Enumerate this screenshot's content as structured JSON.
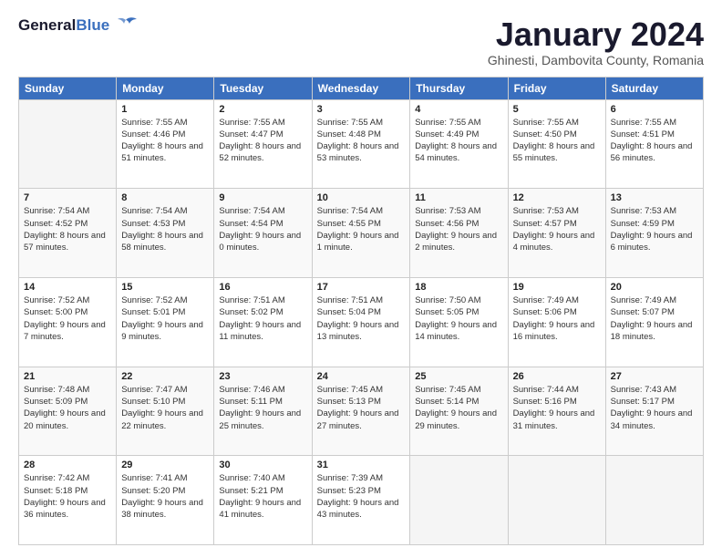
{
  "header": {
    "logo_line1": "General",
    "logo_line2": "Blue",
    "month": "January 2024",
    "location": "Ghinesti, Dambovita County, Romania"
  },
  "weekdays": [
    "Sunday",
    "Monday",
    "Tuesday",
    "Wednesday",
    "Thursday",
    "Friday",
    "Saturday"
  ],
  "weeks": [
    [
      {
        "day": "",
        "sunrise": "",
        "sunset": "",
        "daylight": "",
        "empty": true
      },
      {
        "day": "1",
        "sunrise": "Sunrise: 7:55 AM",
        "sunset": "Sunset: 4:46 PM",
        "daylight": "Daylight: 8 hours and 51 minutes."
      },
      {
        "day": "2",
        "sunrise": "Sunrise: 7:55 AM",
        "sunset": "Sunset: 4:47 PM",
        "daylight": "Daylight: 8 hours and 52 minutes."
      },
      {
        "day": "3",
        "sunrise": "Sunrise: 7:55 AM",
        "sunset": "Sunset: 4:48 PM",
        "daylight": "Daylight: 8 hours and 53 minutes."
      },
      {
        "day": "4",
        "sunrise": "Sunrise: 7:55 AM",
        "sunset": "Sunset: 4:49 PM",
        "daylight": "Daylight: 8 hours and 54 minutes."
      },
      {
        "day": "5",
        "sunrise": "Sunrise: 7:55 AM",
        "sunset": "Sunset: 4:50 PM",
        "daylight": "Daylight: 8 hours and 55 minutes."
      },
      {
        "day": "6",
        "sunrise": "Sunrise: 7:55 AM",
        "sunset": "Sunset: 4:51 PM",
        "daylight": "Daylight: 8 hours and 56 minutes."
      }
    ],
    [
      {
        "day": "7",
        "sunrise": "Sunrise: 7:54 AM",
        "sunset": "Sunset: 4:52 PM",
        "daylight": "Daylight: 8 hours and 57 minutes."
      },
      {
        "day": "8",
        "sunrise": "Sunrise: 7:54 AM",
        "sunset": "Sunset: 4:53 PM",
        "daylight": "Daylight: 8 hours and 58 minutes."
      },
      {
        "day": "9",
        "sunrise": "Sunrise: 7:54 AM",
        "sunset": "Sunset: 4:54 PM",
        "daylight": "Daylight: 9 hours and 0 minutes."
      },
      {
        "day": "10",
        "sunrise": "Sunrise: 7:54 AM",
        "sunset": "Sunset: 4:55 PM",
        "daylight": "Daylight: 9 hours and 1 minute."
      },
      {
        "day": "11",
        "sunrise": "Sunrise: 7:53 AM",
        "sunset": "Sunset: 4:56 PM",
        "daylight": "Daylight: 9 hours and 2 minutes."
      },
      {
        "day": "12",
        "sunrise": "Sunrise: 7:53 AM",
        "sunset": "Sunset: 4:57 PM",
        "daylight": "Daylight: 9 hours and 4 minutes."
      },
      {
        "day": "13",
        "sunrise": "Sunrise: 7:53 AM",
        "sunset": "Sunset: 4:59 PM",
        "daylight": "Daylight: 9 hours and 6 minutes."
      }
    ],
    [
      {
        "day": "14",
        "sunrise": "Sunrise: 7:52 AM",
        "sunset": "Sunset: 5:00 PM",
        "daylight": "Daylight: 9 hours and 7 minutes."
      },
      {
        "day": "15",
        "sunrise": "Sunrise: 7:52 AM",
        "sunset": "Sunset: 5:01 PM",
        "daylight": "Daylight: 9 hours and 9 minutes."
      },
      {
        "day": "16",
        "sunrise": "Sunrise: 7:51 AM",
        "sunset": "Sunset: 5:02 PM",
        "daylight": "Daylight: 9 hours and 11 minutes."
      },
      {
        "day": "17",
        "sunrise": "Sunrise: 7:51 AM",
        "sunset": "Sunset: 5:04 PM",
        "daylight": "Daylight: 9 hours and 13 minutes."
      },
      {
        "day": "18",
        "sunrise": "Sunrise: 7:50 AM",
        "sunset": "Sunset: 5:05 PM",
        "daylight": "Daylight: 9 hours and 14 minutes."
      },
      {
        "day": "19",
        "sunrise": "Sunrise: 7:49 AM",
        "sunset": "Sunset: 5:06 PM",
        "daylight": "Daylight: 9 hours and 16 minutes."
      },
      {
        "day": "20",
        "sunrise": "Sunrise: 7:49 AM",
        "sunset": "Sunset: 5:07 PM",
        "daylight": "Daylight: 9 hours and 18 minutes."
      }
    ],
    [
      {
        "day": "21",
        "sunrise": "Sunrise: 7:48 AM",
        "sunset": "Sunset: 5:09 PM",
        "daylight": "Daylight: 9 hours and 20 minutes."
      },
      {
        "day": "22",
        "sunrise": "Sunrise: 7:47 AM",
        "sunset": "Sunset: 5:10 PM",
        "daylight": "Daylight: 9 hours and 22 minutes."
      },
      {
        "day": "23",
        "sunrise": "Sunrise: 7:46 AM",
        "sunset": "Sunset: 5:11 PM",
        "daylight": "Daylight: 9 hours and 25 minutes."
      },
      {
        "day": "24",
        "sunrise": "Sunrise: 7:45 AM",
        "sunset": "Sunset: 5:13 PM",
        "daylight": "Daylight: 9 hours and 27 minutes."
      },
      {
        "day": "25",
        "sunrise": "Sunrise: 7:45 AM",
        "sunset": "Sunset: 5:14 PM",
        "daylight": "Daylight: 9 hours and 29 minutes."
      },
      {
        "day": "26",
        "sunrise": "Sunrise: 7:44 AM",
        "sunset": "Sunset: 5:16 PM",
        "daylight": "Daylight: 9 hours and 31 minutes."
      },
      {
        "day": "27",
        "sunrise": "Sunrise: 7:43 AM",
        "sunset": "Sunset: 5:17 PM",
        "daylight": "Daylight: 9 hours and 34 minutes."
      }
    ],
    [
      {
        "day": "28",
        "sunrise": "Sunrise: 7:42 AM",
        "sunset": "Sunset: 5:18 PM",
        "daylight": "Daylight: 9 hours and 36 minutes."
      },
      {
        "day": "29",
        "sunrise": "Sunrise: 7:41 AM",
        "sunset": "Sunset: 5:20 PM",
        "daylight": "Daylight: 9 hours and 38 minutes."
      },
      {
        "day": "30",
        "sunrise": "Sunrise: 7:40 AM",
        "sunset": "Sunset: 5:21 PM",
        "daylight": "Daylight: 9 hours and 41 minutes."
      },
      {
        "day": "31",
        "sunrise": "Sunrise: 7:39 AM",
        "sunset": "Sunset: 5:23 PM",
        "daylight": "Daylight: 9 hours and 43 minutes."
      },
      {
        "day": "",
        "sunrise": "",
        "sunset": "",
        "daylight": "",
        "empty": true
      },
      {
        "day": "",
        "sunrise": "",
        "sunset": "",
        "daylight": "",
        "empty": true
      },
      {
        "day": "",
        "sunrise": "",
        "sunset": "",
        "daylight": "",
        "empty": true
      }
    ]
  ]
}
